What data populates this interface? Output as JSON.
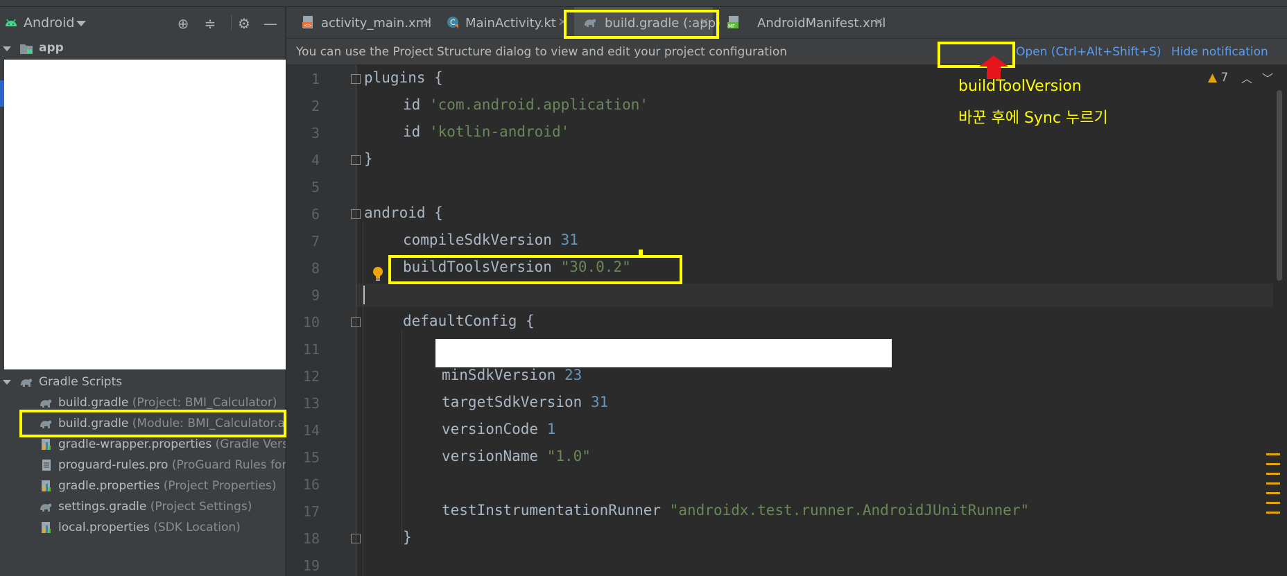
{
  "project_panel": {
    "title": "Android",
    "root_module": "app",
    "gradle_scripts_label": "Gradle Scripts",
    "files": [
      {
        "name": "build.gradle",
        "hint": "(Project: BMI_Calculator)"
      },
      {
        "name": "build.gradle",
        "hint": "(Module: BMI_Calculator.ap"
      },
      {
        "name": "gradle-wrapper.properties",
        "hint": "(Gradle Versic"
      },
      {
        "name": "proguard-rules.pro",
        "hint": "(ProGuard Rules for I"
      },
      {
        "name": "gradle.properties",
        "hint": "(Project Properties)"
      },
      {
        "name": "settings.gradle",
        "hint": "(Project Settings)"
      },
      {
        "name": "local.properties",
        "hint": "(SDK Location)"
      }
    ]
  },
  "tabs": [
    {
      "label": "activity_main.xml"
    },
    {
      "label": "MainActivity.kt"
    },
    {
      "label": "build.gradle (:app)"
    },
    {
      "label": "AndroidManifest.xml"
    }
  ],
  "notification": {
    "message": "You can use the Project Structure dialog to view and edit your project configuration",
    "open_link": "Open (Ctrl+Alt+Shift+S)",
    "hide_link": "Hide notification"
  },
  "inspections": {
    "warning_count": "7"
  },
  "annotation": {
    "line1": "buildToolVersion",
    "line2": "바꾼 후에 Sync 누르기"
  },
  "editor": {
    "line_numbers": [
      "1",
      "2",
      "3",
      "4",
      "5",
      "6",
      "7",
      "8",
      "9",
      "10",
      "11",
      "12",
      "13",
      "14",
      "15",
      "16",
      "17",
      "18",
      "19"
    ],
    "code": {
      "l1": "plugins {",
      "l2_kw": "id ",
      "l2_str": "'com.android.application'",
      "l3_kw": "id ",
      "l3_str": "'kotlin-android'",
      "l4": "}",
      "l6": "android {",
      "l7_kw": "compileSdkVersion ",
      "l7_num": "31",
      "l8_kw": "buildToolsVersion ",
      "l8_str": "\"30.0.2\"",
      "l10": "defaultConfig {",
      "l12_kw": "minSdkVersion ",
      "l12_num": "23",
      "l13_kw": "targetSdkVersion ",
      "l13_num": "31",
      "l14_kw": "versionCode ",
      "l14_num": "1",
      "l15_kw": "versionName ",
      "l15_str": "\"1.0\"",
      "l17_kw": "testInstrumentationRunner ",
      "l17_str": "\"androidx.test.runner.AndroidJUnitRunner\"",
      "l18": "}"
    }
  },
  "colors": {
    "highlight": "#ffff00",
    "arrow": "#e8141b",
    "link": "#589df6"
  }
}
